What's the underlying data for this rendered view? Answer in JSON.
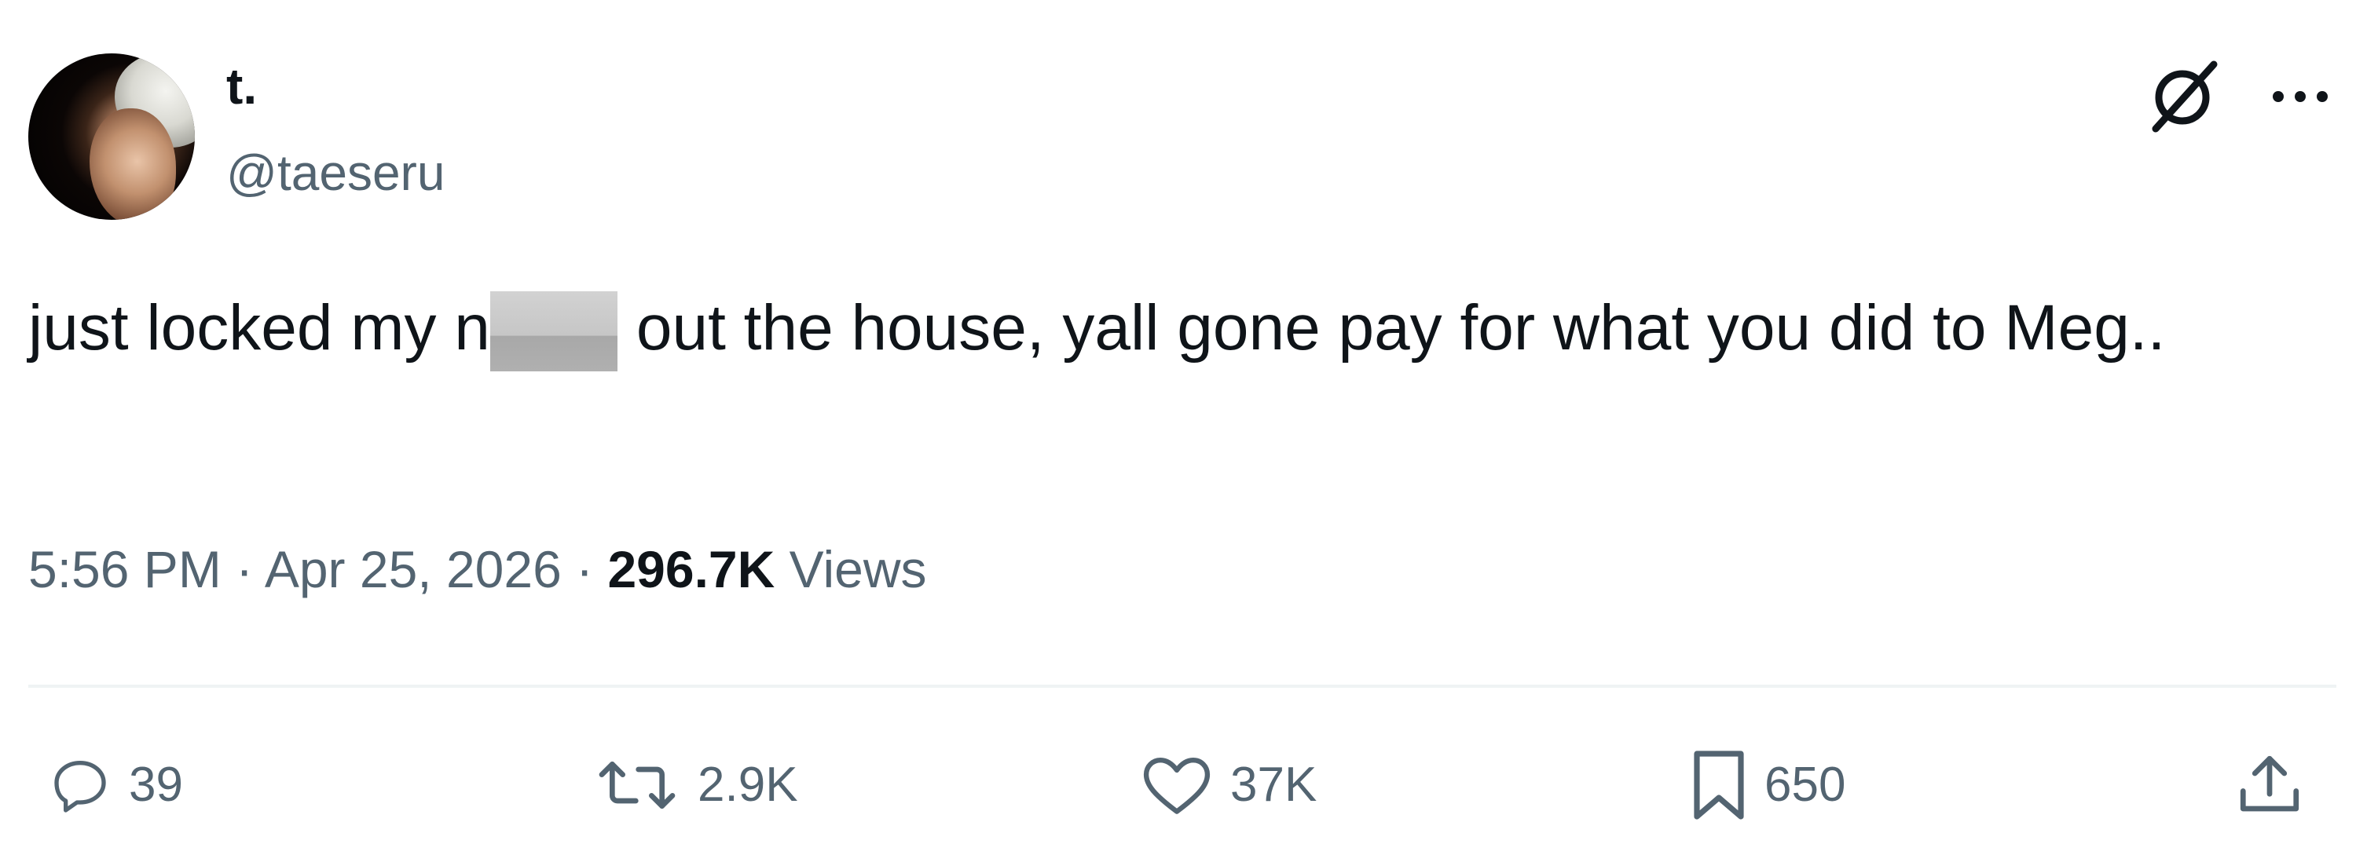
{
  "author": {
    "display_name": "t.",
    "handle": "@taeseru"
  },
  "tweet": {
    "text_before": "just locked my n",
    "text_after": "out the house, yall gone pay for what you did to Meg.."
  },
  "meta": {
    "time": "5:56 PM",
    "separator": "·",
    "date": "Apr 25, 2026",
    "views_count": "296.7K",
    "views_label": "Views"
  },
  "actions": {
    "replies": "39",
    "retweets": "2.9K",
    "likes": "37K",
    "bookmarks": "650"
  },
  "icons": {
    "reply": "speech-bubble-icon",
    "retweet": "retweet-arrows-icon",
    "like": "heart-icon",
    "bookmark": "bookmark-icon",
    "share": "share-upload-icon",
    "grok": "grok-slash-circle-icon",
    "more": "ellipsis-icon"
  },
  "colors": {
    "text_primary": "#0f1419",
    "text_secondary": "#536471",
    "divider": "#eff3f4"
  }
}
